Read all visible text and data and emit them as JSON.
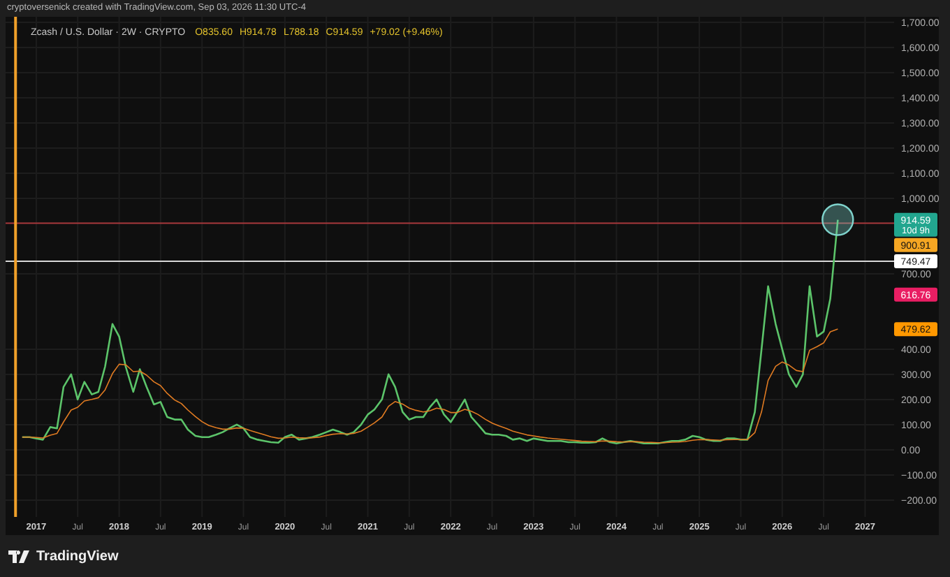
{
  "header": {
    "attribution": "cryptoversenick created with TradingView.com, Sep 03, 2026 11:30 UTC-4"
  },
  "legend": {
    "symbol": "Zcash / U.S. Dollar · 2W · CRYPTO",
    "ohlc": [
      "O835.60",
      "H914.78",
      "L788.18",
      "C914.59"
    ],
    "change": "+79.02 (+9.46%)"
  },
  "chart": {
    "highlight": {
      "color": "#7fd3cc"
    },
    "price_labels": [
      {
        "label": "914.59",
        "sublabel": "10d 9h",
        "color": "#22a68f"
      },
      {
        "label": "900.91",
        "color": "#f5a623"
      },
      {
        "label": "749.47",
        "color": "#ffffff"
      },
      {
        "label": "616.76",
        "color": "#e91e63"
      },
      {
        "label": "479.62",
        "color": "#ff9800"
      }
    ],
    "chart_data": {
      "type": "line",
      "grid": true,
      "xlim": [
        2016.63,
        2027.35
      ],
      "ylim": [
        -267,
        1722
      ],
      "x": [
        2016.83,
        2016.92,
        2017.0,
        2017.08,
        2017.17,
        2017.25,
        2017.33,
        2017.42,
        2017.5,
        2017.58,
        2017.67,
        2017.75,
        2017.83,
        2017.92,
        2018.0,
        2018.08,
        2018.17,
        2018.25,
        2018.33,
        2018.42,
        2018.5,
        2018.58,
        2018.67,
        2018.75,
        2018.83,
        2018.92,
        2019.0,
        2019.08,
        2019.17,
        2019.25,
        2019.33,
        2019.42,
        2019.5,
        2019.58,
        2019.67,
        2019.75,
        2019.83,
        2019.92,
        2020.0,
        2020.08,
        2020.17,
        2020.25,
        2020.33,
        2020.42,
        2020.5,
        2020.58,
        2020.67,
        2020.75,
        2020.83,
        2020.92,
        2021.0,
        2021.08,
        2021.17,
        2021.25,
        2021.33,
        2021.42,
        2021.5,
        2021.58,
        2021.67,
        2021.75,
        2021.83,
        2021.92,
        2022.0,
        2022.08,
        2022.17,
        2022.25,
        2022.33,
        2022.42,
        2022.5,
        2022.58,
        2022.67,
        2022.75,
        2022.83,
        2022.92,
        2023.0,
        2023.08,
        2023.17,
        2023.25,
        2023.33,
        2023.42,
        2023.5,
        2023.58,
        2023.67,
        2023.75,
        2023.83,
        2023.92,
        2024.0,
        2024.08,
        2024.17,
        2024.25,
        2024.33,
        2024.42,
        2024.5,
        2024.58,
        2024.67,
        2024.75,
        2024.83,
        2024.92,
        2025.0,
        2025.08,
        2025.17,
        2025.25,
        2025.33,
        2025.42,
        2025.5,
        2025.58,
        2025.67,
        2025.75,
        2025.83,
        2025.92,
        2026.0,
        2026.08,
        2026.17,
        2026.25,
        2026.33,
        2026.42,
        2026.5,
        2026.58,
        2026.67
      ],
      "series": [
        {
          "color": "#5cc46a",
          "values": [
            50,
            50,
            45,
            40,
            90,
            85,
            250,
            300,
            200,
            270,
            220,
            230,
            330,
            500,
            450,
            330,
            230,
            320,
            250,
            180,
            190,
            130,
            120,
            120,
            80,
            55,
            50,
            50,
            60,
            70,
            85,
            100,
            85,
            50,
            40,
            35,
            30,
            28,
            50,
            60,
            40,
            45,
            50,
            60,
            70,
            80,
            70,
            60,
            70,
            100,
            140,
            160,
            200,
            300,
            250,
            150,
            120,
            130,
            130,
            170,
            200,
            140,
            110,
            150,
            200,
            130,
            100,
            65,
            60,
            60,
            55,
            40,
            45,
            35,
            45,
            40,
            35,
            35,
            35,
            30,
            30,
            28,
            28,
            30,
            45,
            30,
            25,
            30,
            35,
            30,
            25,
            25,
            25,
            30,
            35,
            35,
            40,
            55,
            50,
            40,
            35,
            35,
            45,
            45,
            40,
            40,
            150,
            400,
            650,
            500,
            400,
            300,
            250,
            300,
            650,
            450,
            470,
            600,
            915
          ]
        },
        {
          "color": "#e07b22",
          "values": [
            50,
            50,
            49,
            47,
            58,
            65,
            111,
            158,
            169,
            194,
            200,
            207,
            238,
            303,
            340,
            338,
            311,
            313,
            297,
            270,
            255,
            224,
            198,
            184,
            158,
            132,
            112,
            97,
            88,
            82,
            82,
            87,
            86,
            77,
            68,
            60,
            52,
            46,
            47,
            50,
            48,
            47,
            48,
            51,
            57,
            62,
            64,
            63,
            65,
            74,
            90,
            107,
            130,
            173,
            192,
            182,
            166,
            157,
            150,
            155,
            166,
            160,
            148,
            148,
            161,
            153,
            140,
            121,
            106,
            95,
            85,
            74,
            67,
            59,
            55,
            51,
            47,
            44,
            42,
            39,
            37,
            34,
            33,
            32,
            35,
            34,
            32,
            31,
            32,
            32,
            30,
            29,
            28,
            28,
            30,
            31,
            33,
            38,
            41,
            40,
            39,
            38,
            40,
            41,
            41,
            41,
            68,
            151,
            276,
            332,
            349,
            337,
            315,
            311,
            396,
            410,
            425,
            469,
            480
          ]
        }
      ],
      "yticks": [
        {
          "value": 1700,
          "label": "1,700.00"
        },
        {
          "value": 1600,
          "label": "1,600.00"
        },
        {
          "value": 1500,
          "label": "1,500.00"
        },
        {
          "value": 1400,
          "label": "1,400.00"
        },
        {
          "value": 1300,
          "label": "1,300.00"
        },
        {
          "value": 1200,
          "label": "1,200.00"
        },
        {
          "value": 1100,
          "label": "1,100.00"
        },
        {
          "value": 1000,
          "label": "1,000.00"
        },
        {
          "value": 700,
          "label": "700.00"
        },
        {
          "value": 400,
          "label": "400.00"
        },
        {
          "value": 300,
          "label": "300.00"
        },
        {
          "value": 200,
          "label": "200.00"
        },
        {
          "value": 100,
          "label": "100.00"
        },
        {
          "value": 0,
          "label": "0.00"
        },
        {
          "value": -100,
          "label": "−100.00"
        },
        {
          "value": -200,
          "label": "−200.00"
        }
      ],
      "xticks": [
        {
          "value": 2017,
          "label": "2017"
        },
        {
          "value": 2017.5,
          "label": "Jul"
        },
        {
          "value": 2018,
          "label": "2018"
        },
        {
          "value": 2018.5,
          "label": "Jul"
        },
        {
          "value": 2019,
          "label": "2019"
        },
        {
          "value": 2019.5,
          "label": "Jul"
        },
        {
          "value": 2020,
          "label": "2020"
        },
        {
          "value": 2020.5,
          "label": "Jul"
        },
        {
          "value": 2021,
          "label": "2021"
        },
        {
          "value": 2021.5,
          "label": "Jul"
        },
        {
          "value": 2022,
          "label": "2022"
        },
        {
          "value": 2022.5,
          "label": "Jul"
        },
        {
          "value": 2023,
          "label": "2023"
        },
        {
          "value": 2023.5,
          "label": "Jul"
        },
        {
          "value": 2024,
          "label": "2024"
        },
        {
          "value": 2024.5,
          "label": "Jul"
        },
        {
          "value": 2025,
          "label": "2025"
        },
        {
          "value": 2025.5,
          "label": "Jul"
        },
        {
          "value": 2026,
          "label": "2026"
        },
        {
          "value": 2026.5,
          "label": "Jul"
        },
        {
          "value": 2027,
          "label": "2027"
        }
      ],
      "ref_lines": [
        {
          "axis": "y",
          "value": 900.91,
          "color": "#a8383c"
        },
        {
          "axis": "y",
          "value": 749.47,
          "color": "#d8d8d8"
        },
        {
          "axis": "x",
          "value": 2016.75,
          "color": "#f0a02a"
        }
      ]
    }
  },
  "footer": {
    "brand": "TradingView"
  }
}
